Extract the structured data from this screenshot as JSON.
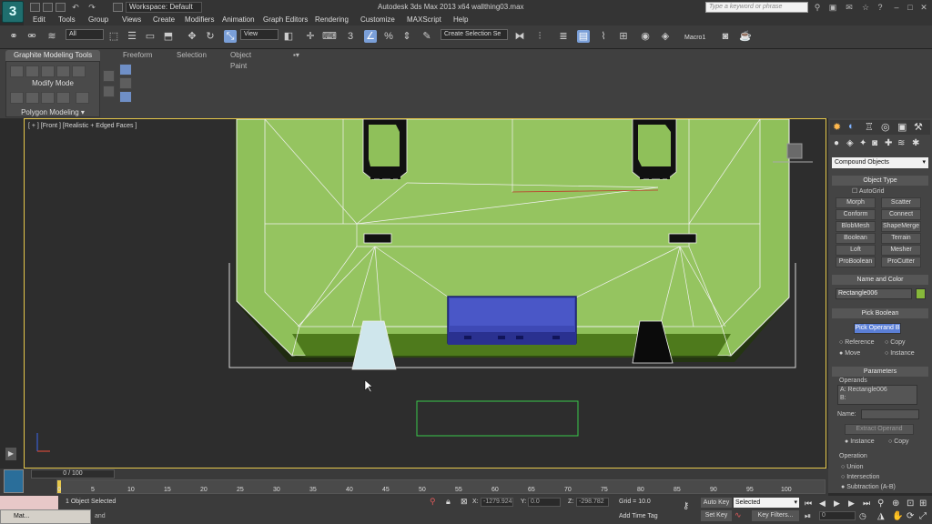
{
  "titlebar": {
    "workspace": "Workspace: Default",
    "title": "Autodesk 3ds Max  2013 x64      wallthing03.max",
    "search_placeholder": "Type a keyword or phrase"
  },
  "app_logo": "3",
  "menus": [
    "Edit",
    "Tools",
    "Group",
    "Views",
    "Create",
    "Modifiers",
    "Animation",
    "Graph Editors",
    "Rendering",
    "Customize",
    "MAXScript",
    "Help"
  ],
  "toolbar": {
    "filter": "All",
    "ref_coord": "View",
    "selection_set": "Create Selection Se",
    "snap_value": "3",
    "percent": "%",
    "macro": "Macro1"
  },
  "ribbon": {
    "tabs": [
      "Graphite Modeling Tools",
      "Freeform",
      "Selection",
      "Object Paint"
    ],
    "panel_modify": "Modify Mode",
    "panel_poly": "Polygon Modeling"
  },
  "viewport": {
    "label": "[ + ] [Front ] [Realistic + Edged Faces ]"
  },
  "command_panel": {
    "category": "Compound Objects",
    "object_type_title": "Object Type",
    "autogrid": "AutoGrid",
    "buttons": [
      "Morph",
      "Scatter",
      "Conform",
      "Connect",
      "BlobMesh",
      "ShapeMerge",
      "Boolean",
      "Terrain",
      "Loft",
      "Mesher",
      "ProBoolean",
      "ProCutter"
    ],
    "name_color_title": "Name and Color",
    "object_name": "Rectangle006",
    "pick_boolean_title": "Pick Boolean",
    "pick_operand": "Pick Operand B",
    "pick_options": [
      "Reference",
      "Copy",
      "Move",
      "Instance"
    ],
    "parameters_title": "Parameters",
    "operands_label": "Operands",
    "operands": [
      "A: Rectangle006",
      "B:"
    ],
    "name_label": "Name:",
    "extract_operand": "Extract Operand",
    "extract_options": [
      "Instance",
      "Copy"
    ],
    "operation_label": "Operation",
    "operations": [
      "Union",
      "Intersection",
      "Subtraction (A-B)"
    ]
  },
  "timeline": {
    "frame": "0 / 100",
    "ticks": [
      "0",
      "5",
      "10",
      "15",
      "20",
      "25",
      "30",
      "35",
      "40",
      "45",
      "50",
      "55",
      "60",
      "65",
      "70",
      "75",
      "80",
      "85",
      "90",
      "95",
      "100"
    ]
  },
  "status": {
    "selected": "1 Object Selected",
    "prompt": "and",
    "x_label": "X:",
    "x_val": "-1279.924",
    "y_label": "Y:",
    "y_val": "0.0",
    "z_label": "Z:",
    "z_val": "-298.782",
    "grid": "Grid = 10.0",
    "add_time_tag": "Add Time Tag",
    "auto_key": "Auto Key",
    "set_key": "Set Key",
    "key_mode": "Selected",
    "key_filters": "Key Filters...",
    "frame_field": "0",
    "taskbar_item": "Mat..."
  },
  "colors": {
    "viewport_bg": "#2d2d2d",
    "model_green": "#8fc05a",
    "operand_blue": "#3e49b5",
    "border_yellow": "#e6c84b"
  }
}
